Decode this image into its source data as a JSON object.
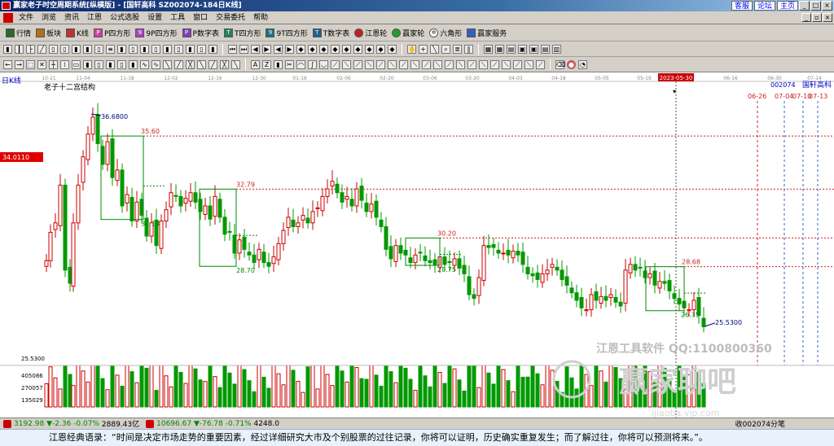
{
  "window": {
    "title": "赢家老子时空周期系统[纵横版] - [国轩高科  SZ002074-184日K线]",
    "links": [
      "客服",
      "论坛",
      "主页"
    ]
  },
  "menu": [
    "文件",
    "浏览",
    "资讯",
    "江恩",
    "公式选股",
    "设置",
    "工具",
    "窗口",
    "交易委托",
    "帮助"
  ],
  "toolbar": [
    "行情",
    "板块",
    "K线",
    "P四方形",
    "9P四方形",
    "P数字表",
    "T四方形",
    "9T四方形",
    "T数字表",
    "江恩轮",
    "赢家轮",
    "六角形",
    "赢家服务"
  ],
  "chart": {
    "period_label": "日K线",
    "indicator_title": "老子十二宫结构",
    "stock_code": "002074",
    "stock_name": "国轩高科",
    "cursor_price": "34.0110",
    "cursor_date": "2023-05-30",
    "date_ticks": [
      "10-21",
      "11-04",
      "11-18",
      "12-02",
      "12-16",
      "12-30",
      "01-16",
      "02-06",
      "02-20",
      "03-06",
      "03-20",
      "04-03",
      "04-18",
      "05-05",
      "05-19",
      "06-16",
      "06-30",
      "07-14"
    ],
    "cycle_dates": [
      "06-26",
      "07-04",
      "07-10",
      "07-13"
    ],
    "price_labels": {
      "high": "36.6800",
      "box1_top": "35.60",
      "box1_bottom": "31.18",
      "box2_top": "32.79",
      "box2_bottom": "28.70",
      "box3_top": "30.20",
      "box3_bottom": "28.75",
      "box4_top": "28.68",
      "box4_bottom": "26.35",
      "last": "25.5300"
    },
    "volume_axis": [
      "25.5300",
      "405086",
      "270057",
      "135029"
    ],
    "watermark": {
      "line1": "江恩工具软件  QQ:1100800360",
      "line2": "赢家聊吧",
      "line3": "ijiaoba.vip.com"
    }
  },
  "status": {
    "sh_index": "3192.98",
    "sh_change": "▼-2.36",
    "sh_pct": "-0.07%",
    "sh_amount": "2889.43亿",
    "sz_index": "10696.67",
    "sz_change": "▼-76.78",
    "sz_pct": "-0.71%",
    "sz_amount": "4248.0",
    "right_text": "收002074分笔"
  },
  "footer": "江恩经典语录：“时间是决定市场走势的重要因素，经过详细研究大市及个别股票的过往记录，你将可以证明，历史确实重复发生；而了解过往，你将可以预测将来。”。",
  "colors": {
    "up": "#cc0000",
    "down": "#009900",
    "box": "#008800",
    "guide": "#cc2222",
    "cycle": "#3366cc"
  }
}
